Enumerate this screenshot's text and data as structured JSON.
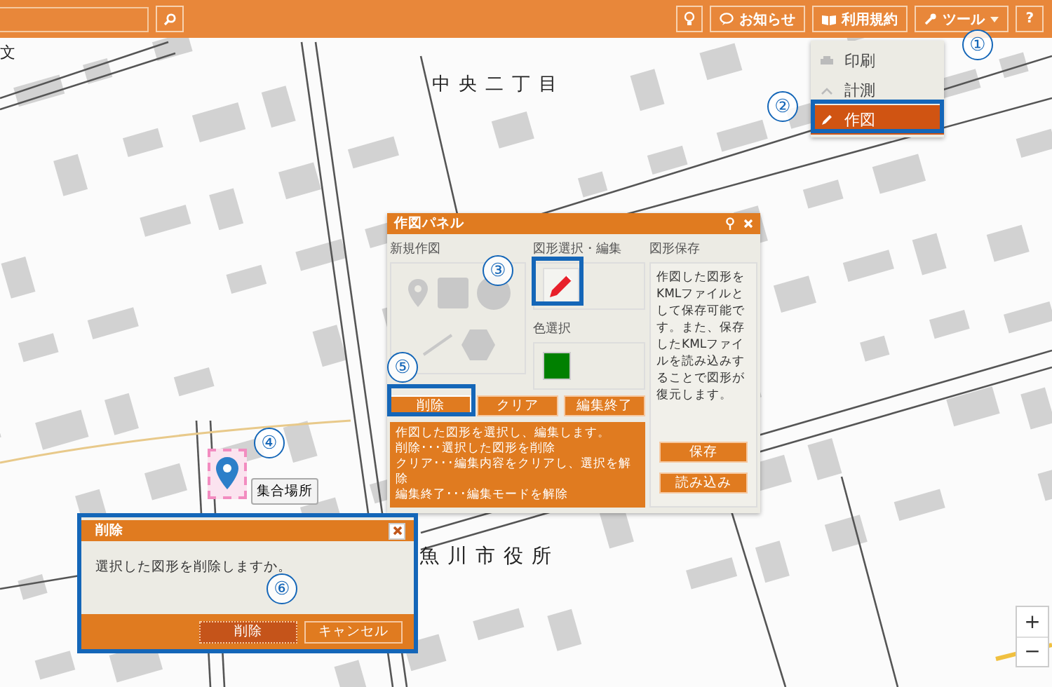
{
  "toolbar": {
    "buttons": [
      {
        "label": "お知らせ",
        "kind": "notice"
      },
      {
        "label": "利用規約",
        "kind": "terms"
      },
      {
        "label": "ツール",
        "kind": "tools",
        "expanded": true
      }
    ],
    "help_button": "?"
  },
  "tools_menu": {
    "items": [
      {
        "label": "印刷",
        "kind": "print",
        "selected": false
      },
      {
        "label": "計測",
        "kind": "measure",
        "selected": false
      },
      {
        "label": "作図",
        "kind": "draw",
        "selected": true
      }
    ]
  },
  "map": {
    "labels": [
      {
        "text": "中央二丁目",
        "kind": "district"
      },
      {
        "text": "魚川市役所",
        "kind": "facility"
      },
      {
        "text": "文",
        "kind": "symbol"
      }
    ],
    "marker": {
      "label": "集合場所",
      "selected": true
    },
    "zoom": {
      "in": "+",
      "out": "−"
    }
  },
  "callouts": [
    "①",
    "②",
    "③",
    "④",
    "⑤",
    "⑥"
  ],
  "panel": {
    "title": "作図パネル",
    "new_drawing": {
      "title": "新規作図"
    },
    "edit": {
      "title": "図形選択・編集",
      "color_title": "色選択",
      "color": "#008000"
    },
    "save": {
      "title": "図形保存",
      "description": "作図した図形をKMLファイルとして保存可能です。また、保存したKMLファイルを読み込みすることで図形が復元します。",
      "buttons": [
        "保存",
        "読み込み"
      ]
    },
    "actions": [
      {
        "label": "削除",
        "selected": true
      },
      {
        "label": "クリア",
        "selected": false
      },
      {
        "label": "編集終了",
        "selected": false
      }
    ],
    "help_lines": [
      "作図した図形を選択し、編集します。",
      "削除･･･選択した図形を削除",
      "クリア･･･編集内容をクリアし、選択を解除",
      "編集終了･･･編集モードを解除"
    ]
  },
  "dialog": {
    "title": "削除",
    "message": "選択した図形を削除しますか。",
    "buttons": [
      {
        "label": "削除",
        "selected": true
      },
      {
        "label": "キャンセル",
        "selected": false
      }
    ]
  }
}
